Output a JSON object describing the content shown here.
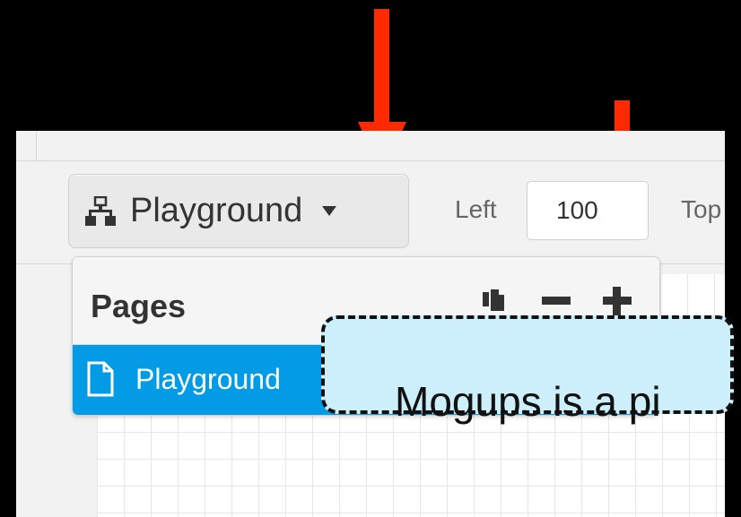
{
  "toolbar": {
    "page_button_label": "Playground",
    "left_label": "Left",
    "left_value": "100",
    "top_label": "Top"
  },
  "dropdown": {
    "title": "Pages",
    "pages": [
      {
        "label": "Playground",
        "selected": true
      }
    ]
  },
  "canvas": {
    "shape_text": "Mogups is a pi"
  },
  "icons": {
    "page_button": "sitemap-icon",
    "copy": "copy-icon",
    "remove": "minus-icon",
    "add": "plus-icon",
    "page": "document-icon"
  },
  "colors": {
    "selected_row": "#039be5",
    "annotation_arrow": "#ff2a00",
    "shape_fill": "#cdeefb"
  }
}
